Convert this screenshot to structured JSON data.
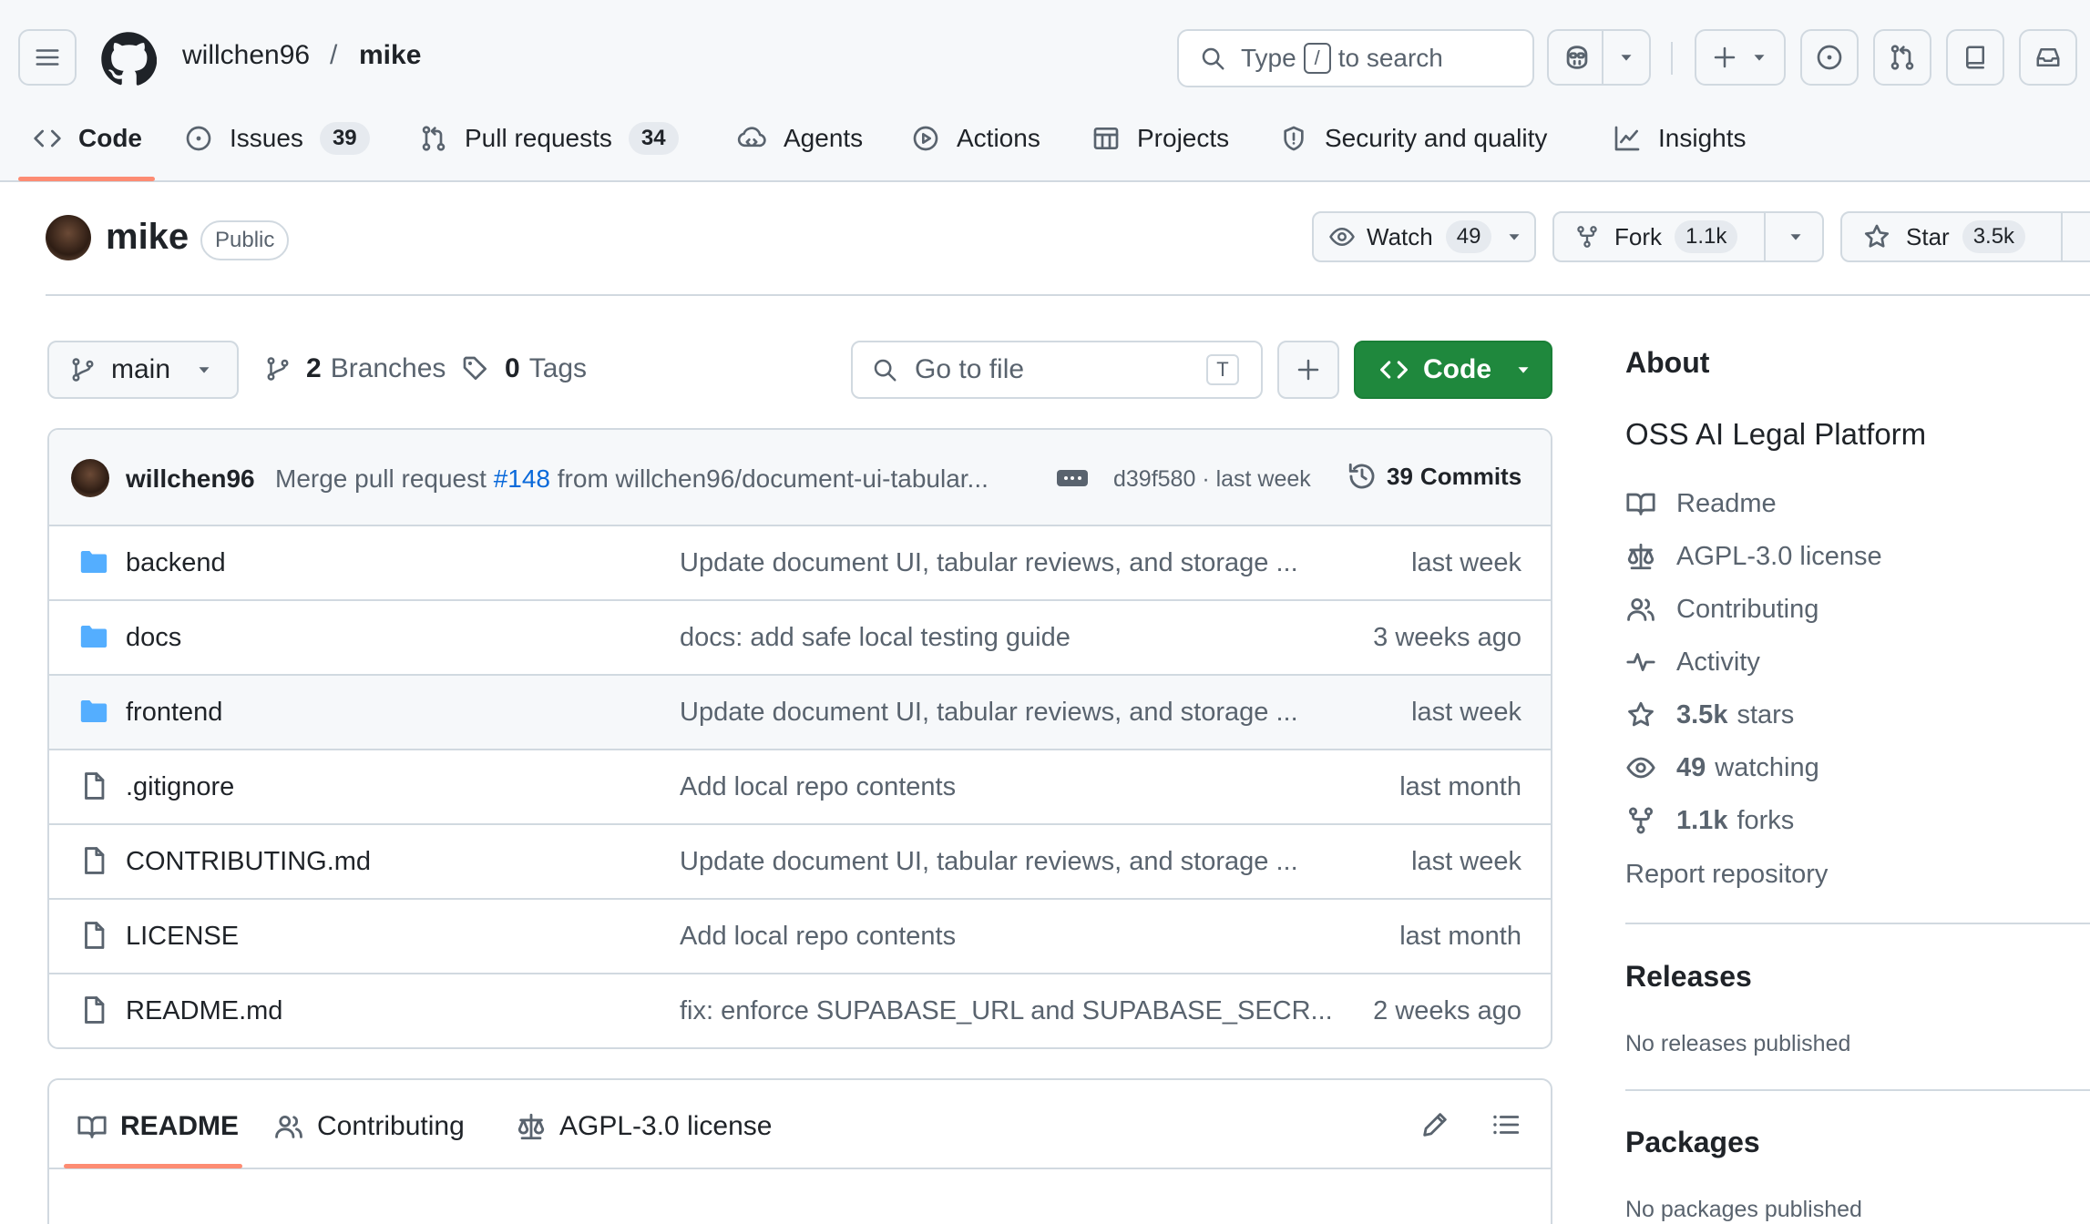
{
  "header": {
    "owner": "willchen96",
    "separator": "/",
    "repo": "mike",
    "search": {
      "prefix": "Type",
      "key": "/",
      "suffix": "to search"
    }
  },
  "tabs": [
    {
      "label": "Code",
      "count": null,
      "icon": "code-icon"
    },
    {
      "label": "Issues",
      "count": "39",
      "icon": "issue-icon"
    },
    {
      "label": "Pull requests",
      "count": "34",
      "icon": "pull-request-icon"
    },
    {
      "label": "Agents",
      "count": null,
      "icon": "agents-icon"
    },
    {
      "label": "Actions",
      "count": null,
      "icon": "play-icon"
    },
    {
      "label": "Projects",
      "count": null,
      "icon": "table-icon"
    },
    {
      "label": "Security and quality",
      "count": null,
      "icon": "shield-icon"
    },
    {
      "label": "Insights",
      "count": null,
      "icon": "graph-icon"
    }
  ],
  "repo_header": {
    "name": "mike",
    "visibility": "Public",
    "watch": {
      "label": "Watch",
      "count": "49"
    },
    "fork": {
      "label": "Fork",
      "count": "1.1k"
    },
    "star": {
      "label": "Star",
      "count": "3.5k"
    }
  },
  "toolbar": {
    "branch": "main",
    "branches_count": "2",
    "branches_label": "Branches",
    "tags_count": "0",
    "tags_label": "Tags",
    "goto_placeholder": "Go to file",
    "goto_key": "T",
    "code_label": "Code"
  },
  "latest_commit": {
    "author": "willchen96",
    "message_prefix": "Merge pull request",
    "pr_link": "#148",
    "message_suffix": "from willchen96/document-ui-tabular...",
    "hash_time": "d39f580 · last week",
    "commits_count": "39",
    "commits_label": "Commits"
  },
  "files": [
    {
      "type": "folder",
      "name": "backend",
      "message": "Update document UI, tabular reviews, and storage ...",
      "date": "last week"
    },
    {
      "type": "folder",
      "name": "docs",
      "message": "docs: add safe local testing guide",
      "date": "3 weeks ago"
    },
    {
      "type": "folder",
      "name": "frontend",
      "message": "Update document UI, tabular reviews, and storage ...",
      "date": "last week"
    },
    {
      "type": "file",
      "name": ".gitignore",
      "message": "Add local repo contents",
      "date": "last month"
    },
    {
      "type": "file",
      "name": "CONTRIBUTING.md",
      "message": "Update document UI, tabular reviews, and storage ...",
      "date": "last week"
    },
    {
      "type": "file",
      "name": "LICENSE",
      "message": "Add local repo contents",
      "date": "last month"
    },
    {
      "type": "file",
      "name": "README.md",
      "message": "fix: enforce SUPABASE_URL and SUPABASE_SECR...",
      "date": "2 weeks ago"
    }
  ],
  "readme_tabs": [
    "README",
    "Contributing",
    "AGPL-3.0 license"
  ],
  "sidebar": {
    "about_title": "About",
    "description": "OSS AI Legal Platform",
    "links": [
      {
        "icon": "book-icon",
        "count": "",
        "label": "Readme"
      },
      {
        "icon": "law-icon",
        "count": "",
        "label": "AGPL-3.0 license"
      },
      {
        "icon": "people-icon",
        "count": "",
        "label": "Contributing"
      },
      {
        "icon": "pulse-icon",
        "count": "",
        "label": "Activity"
      },
      {
        "icon": "star-icon",
        "count": "3.5k",
        "label": "stars"
      },
      {
        "icon": "eye-icon",
        "count": "49",
        "label": "watching"
      },
      {
        "icon": "fork-icon",
        "count": "1.1k",
        "label": "forks"
      }
    ],
    "report": "Report repository",
    "releases_title": "Releases",
    "releases_empty": "No releases published",
    "packages_title": "Packages",
    "packages_empty": "No packages published"
  },
  "colors": {
    "accent_underline": "#fd8c73",
    "code_button": "#1f883d",
    "link": "#0969da",
    "folder": "#54aeff"
  }
}
